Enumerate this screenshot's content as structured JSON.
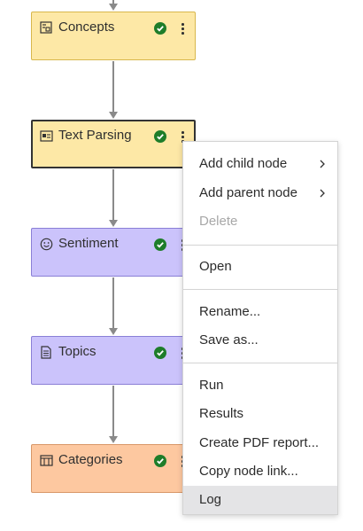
{
  "nodes": [
    {
      "label": "Concepts",
      "icon": "concepts-icon",
      "status": "completed",
      "color": "#fde8a6"
    },
    {
      "label": "Text Parsing",
      "icon": "text-parsing-icon",
      "status": "completed",
      "color": "#fde8a6",
      "selected": true
    },
    {
      "label": "Sentiment",
      "icon": "smiley-icon",
      "status": "completed",
      "color": "#cbc3fb"
    },
    {
      "label": "Topics",
      "icon": "document-icon",
      "status": "completed",
      "color": "#cbc3fb"
    },
    {
      "label": "Categories",
      "icon": "categories-icon",
      "status": "completed",
      "color": "#fdc8a0"
    }
  ],
  "context_menu": {
    "items": [
      {
        "label": "Add child node",
        "submenu": true
      },
      {
        "label": "Add parent node",
        "submenu": true
      },
      {
        "label": "Delete",
        "disabled": true
      },
      {
        "label": "Open"
      },
      {
        "label": "Rename..."
      },
      {
        "label": "Save as..."
      },
      {
        "label": "Run"
      },
      {
        "label": "Results"
      },
      {
        "label": "Create PDF report..."
      },
      {
        "label": "Copy node link..."
      },
      {
        "label": "Log",
        "highlighted": true
      }
    ]
  },
  "colors": {
    "success": "#1e7d2a",
    "edge": "#8a8a8a",
    "menu_highlight": "#e4e4e6"
  }
}
